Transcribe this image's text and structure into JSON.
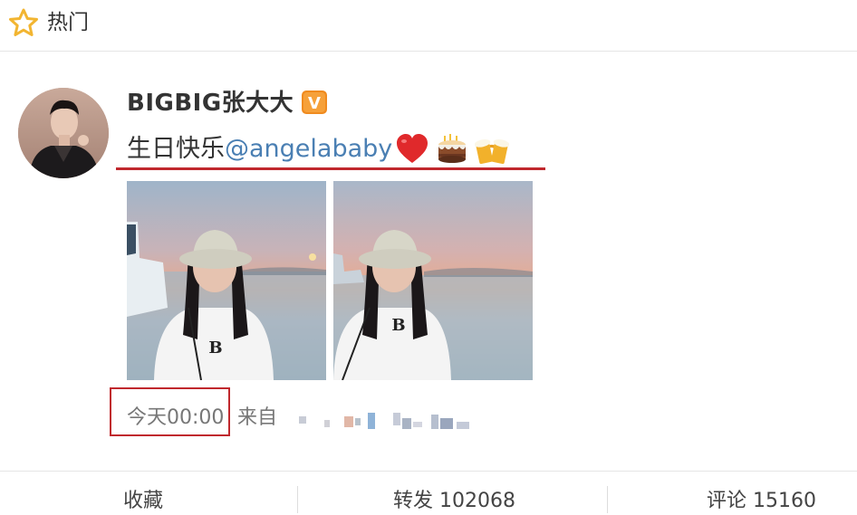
{
  "header": {
    "title": "热门",
    "icon": "star-outline-icon",
    "accent": "#f2b531"
  },
  "post": {
    "author": "BIGBIG张大大",
    "verified_badge": "V",
    "text_prefix": "生日快乐",
    "mention": "@angelababy",
    "emojis": [
      "heart-emoji",
      "birthday-cake-emoji",
      "beer-mugs-emoji"
    ],
    "images": [
      "photo-girl-bucket-hat-sunset-1",
      "photo-girl-bucket-hat-sunset-2"
    ],
    "time": "今天00:00",
    "source_label": "来自"
  },
  "actions": {
    "favorite": "收藏",
    "repost": "转发 102068",
    "comment": "评论 15160"
  },
  "colors": {
    "highlight_red": "#c0282d",
    "mention_blue": "#4a7fb3",
    "verified_orange": "#f08b1f"
  }
}
